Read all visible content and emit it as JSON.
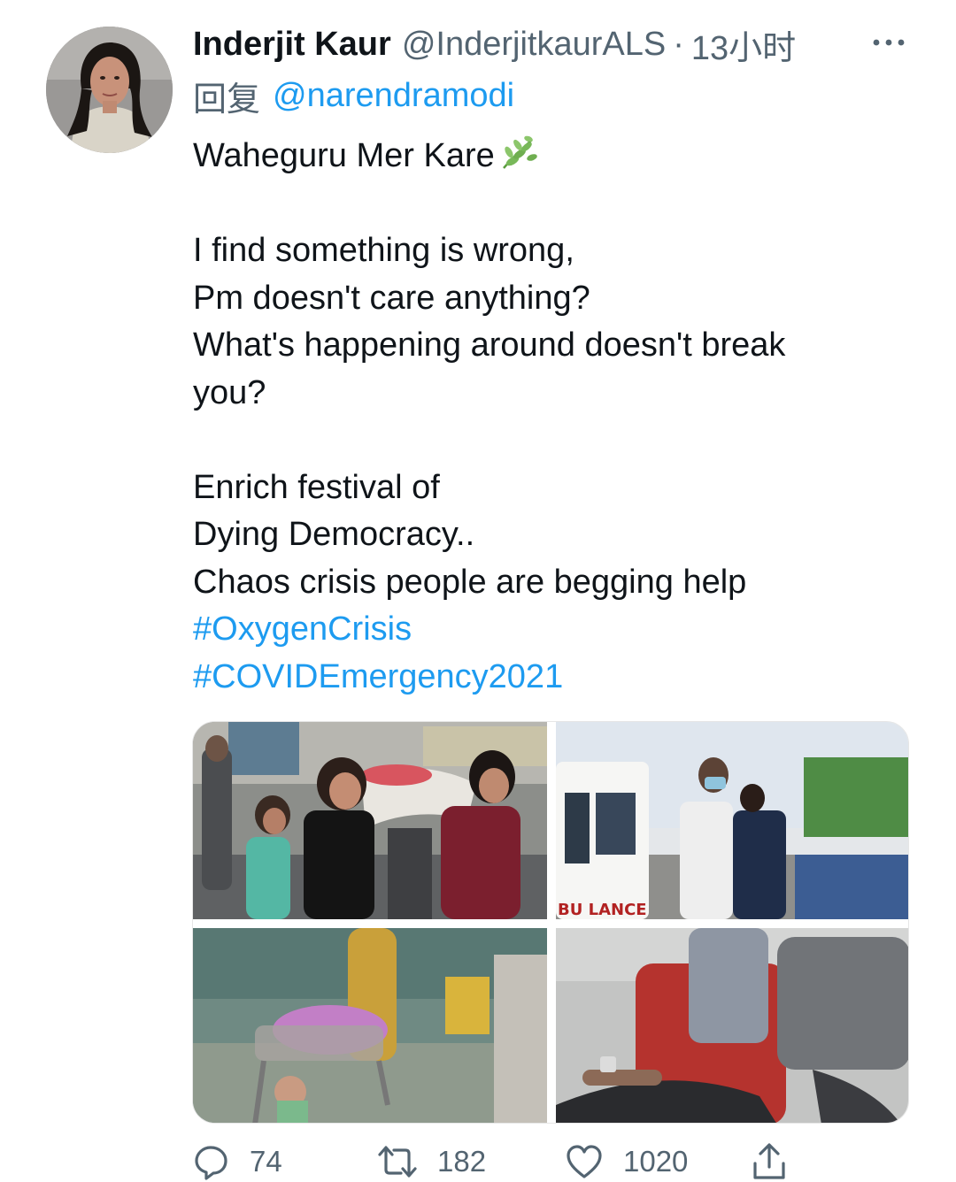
{
  "tweet": {
    "author_name": "Inderjit Kaur",
    "author_handle": "@InderjitkaurALS",
    "separator": "·",
    "time": "13小时",
    "reply_prefix": "回复",
    "reply_to": "@narendramodi",
    "lines": [
      "Waheguru Mer Kare",
      "I find something is wrong,",
      "Pm doesn't care anything?",
      "What's happening around doesn't break",
      "you?",
      "Enrich festival of",
      "Dying Democracy..",
      "Chaos crisis people are begging help"
    ],
    "hashtags": [
      "#OxygenCrisis",
      "#COVIDEmergency2021"
    ],
    "photo_text": "BU LANCE"
  },
  "actions": {
    "replies": "74",
    "retweets": "182",
    "likes": "1020"
  },
  "colors": {
    "link": "#1d9bf0",
    "secondary": "#536471",
    "text": "#0f1419"
  },
  "icons": [
    "more-icon",
    "leaf-emoji-icon",
    "reply-icon",
    "retweet-icon",
    "like-icon",
    "share-icon"
  ]
}
